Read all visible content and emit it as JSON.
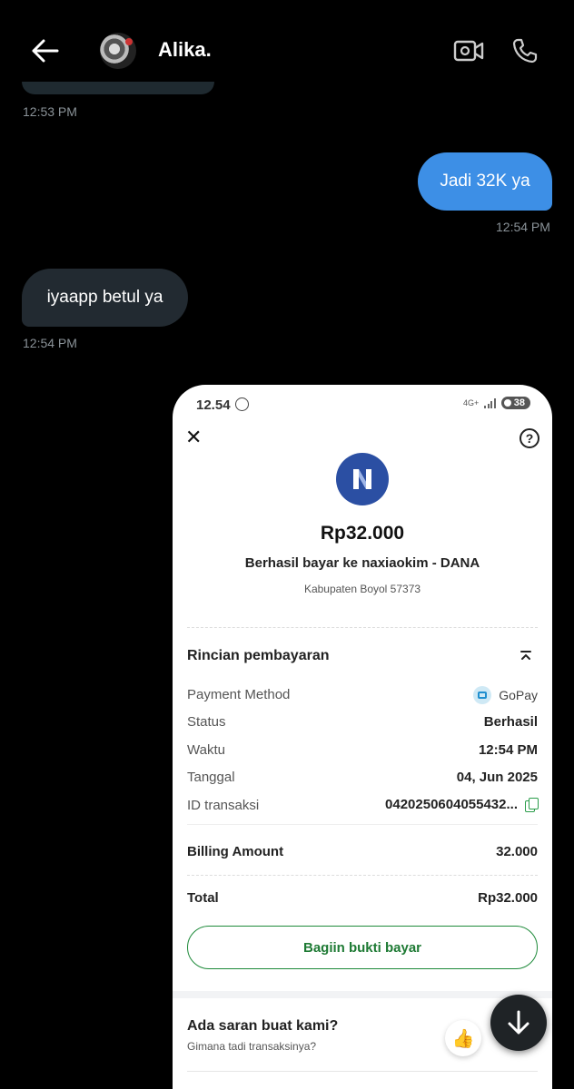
{
  "header": {
    "contact_name": "Alika.",
    "back_icon": "arrow-left-icon",
    "video_icon": "video-call-icon",
    "call_icon": "phone-icon"
  },
  "messages": [
    {
      "direction": "in",
      "text": "",
      "time": "12:53 PM"
    },
    {
      "direction": "out",
      "text": "Jadi 32K ya",
      "time": "12:54 PM"
    },
    {
      "direction": "in",
      "text": "iyaapp betul ya",
      "time": "12:54 PM"
    }
  ],
  "receipt": {
    "status_bar": {
      "time": "12.54",
      "network": "4G+",
      "battery": "38"
    },
    "amount": "Rp32.000",
    "paid_to": "Berhasil bayar ke naxiaokim - DANA",
    "location": "Kabupaten Boyol 57373",
    "details_title": "Rincian pembayaran",
    "details": {
      "payment_method_label": "Payment Method",
      "payment_method_value": "GoPay",
      "status_label": "Status",
      "status_value": "Berhasil",
      "time_label": "Waktu",
      "time_value": "12:54 PM",
      "date_label": "Tanggal",
      "date_value": "04, Jun 2025",
      "txid_label": "ID transaksi",
      "txid_value": "0420250604055432..."
    },
    "billing_label": "Billing Amount",
    "billing_value": "32.000",
    "total_label": "Total",
    "total_value": "Rp32.000",
    "share_button": "Bagiin bukti bayar",
    "feedback_title": "Ada saran buat kami?",
    "feedback_sub": "Gimana tadi transaksinya?"
  },
  "colors": {
    "outgoing_bubble": "#3d8fe6",
    "incoming_bubble": "#222a31",
    "accent_green": "#1e7a34",
    "merchant_logo": "#2b4fa3"
  }
}
